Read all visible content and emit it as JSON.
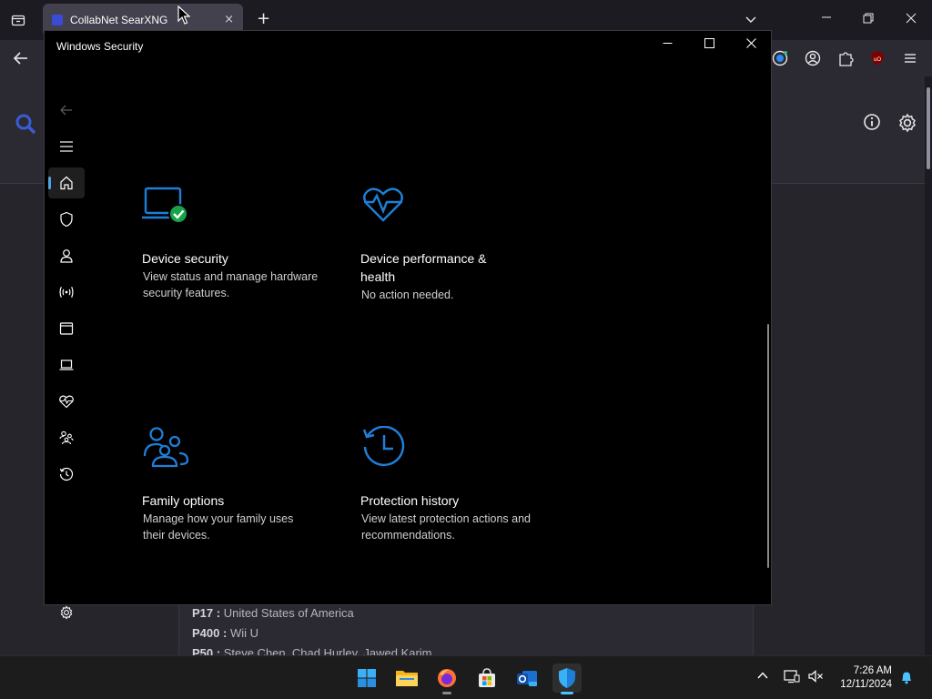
{
  "browser": {
    "tab_title": "CollabNet SearXNG",
    "new_tab_glyph": "+",
    "tab_close_glyph": "×",
    "results": [
      {
        "key": "P17 :",
        "value": "United States of America"
      },
      {
        "key": "P400 :",
        "value": "Wii U"
      },
      {
        "key": "P50 :",
        "value": "Steve Chen, Chad Hurley, Jawed Karim"
      }
    ]
  },
  "winsec": {
    "title": "Windows Security",
    "minimize_glyph": "—",
    "maximize_glyph": "☐",
    "close_glyph": "✕",
    "cards": [
      {
        "title": "Device security",
        "desc": "View status and manage hardware security features.",
        "icon": "laptop-check-icon"
      },
      {
        "title": "Device performance & health",
        "desc": "No action needed.",
        "icon": "heart-pulse-icon"
      },
      {
        "title": "Family options",
        "desc": "Manage how your family uses their devices.",
        "icon": "family-icon"
      },
      {
        "title": "Protection history",
        "desc": "View latest protection actions and recommendations.",
        "icon": "history-icon"
      }
    ]
  },
  "taskbar": {
    "time": "7:26 AM",
    "date": "12/11/2024"
  },
  "colors": {
    "accent": "#4fa3e0",
    "icon_blue": "#1e7fd8",
    "check_green": "#16a34a"
  }
}
